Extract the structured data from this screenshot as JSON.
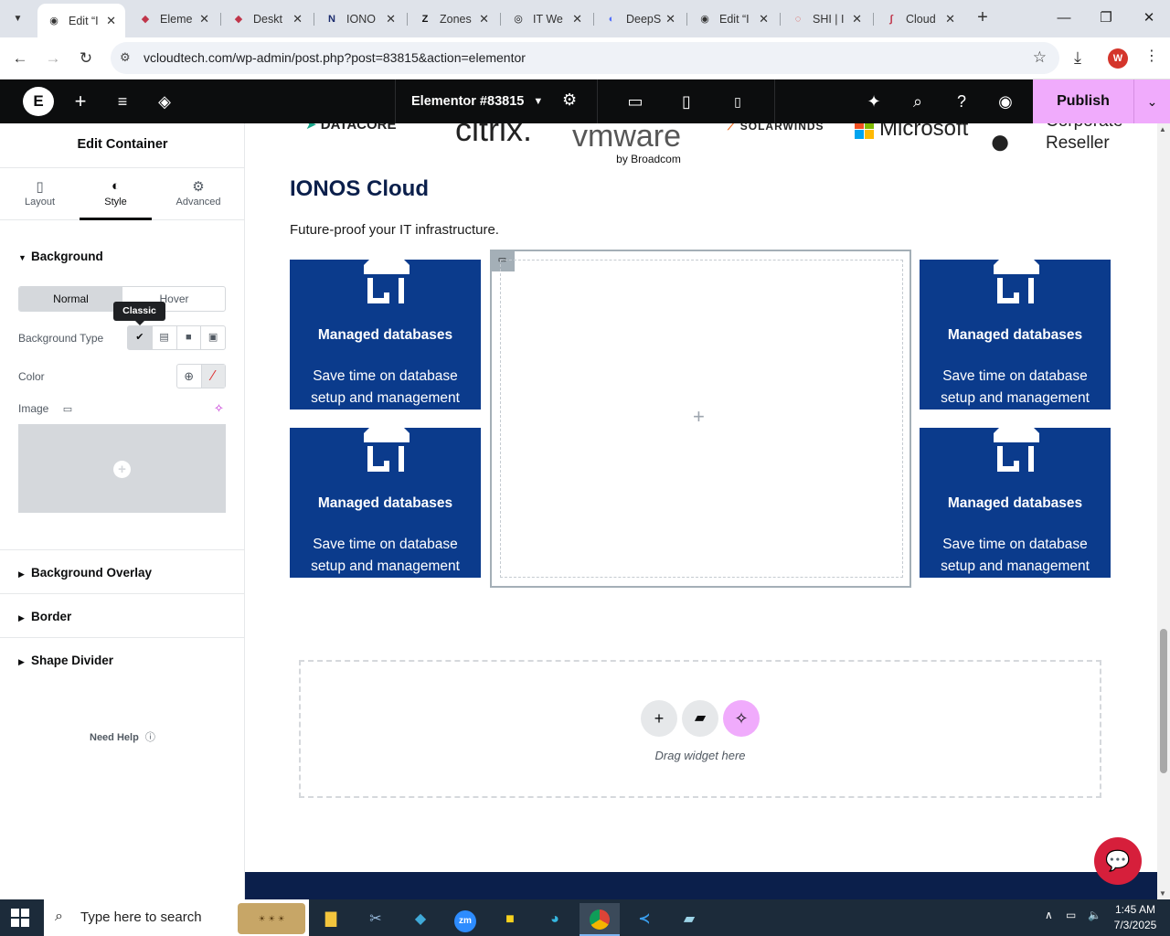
{
  "browser": {
    "tabs": [
      {
        "title": "Edit “I",
        "fav": "◉",
        "favcolor": "#333",
        "active": true
      },
      {
        "title": "Eleme",
        "fav": "◆",
        "favcolor": "#c0354a"
      },
      {
        "title": "Deskt",
        "fav": "◆",
        "favcolor": "#c0354a"
      },
      {
        "title": "IONO",
        "fav": "N",
        "favcolor": "#1a2b6d"
      },
      {
        "title": "Zones",
        "fav": "Z",
        "favcolor": "#111"
      },
      {
        "title": "IT We",
        "fav": "◎",
        "favcolor": "#111"
      },
      {
        "title": "DeepS",
        "fav": "◐",
        "favcolor": "#4d6bfe"
      },
      {
        "title": "Edit “I",
        "fav": "◉",
        "favcolor": "#333"
      },
      {
        "title": "SHI | I",
        "fav": "◌",
        "favcolor": "#d9342b"
      },
      {
        "title": "Cloud",
        "fav": "∫",
        "favcolor": "#c0354a"
      }
    ],
    "close_glyph": "✕",
    "new_tab": "+",
    "url": "vcloudtech.com/wp-admin/post.php?post=83815&action=elementor",
    "profile_initial": "W"
  },
  "elementor": {
    "doc_title": "Elementor #83815",
    "publish_label": "Publish"
  },
  "panel": {
    "title": "Edit Container",
    "tabs": [
      {
        "label": "Layout",
        "icon": "▯"
      },
      {
        "label": "Style",
        "icon": "◐"
      },
      {
        "label": "Advanced",
        "icon": "⚙"
      }
    ],
    "background": {
      "heading": "Background",
      "state_normal": "Normal",
      "state_hover": "Hover",
      "tooltip": "Classic",
      "type_label": "Background Type",
      "color_label": "Color",
      "image_label": "Image"
    },
    "sections": [
      "Background Overlay",
      "Border",
      "Shape Divider"
    ],
    "need_help": "Need Help"
  },
  "canvas": {
    "partner_logos": [
      {
        "text": "DATACORE",
        "color": "#1d6fb8"
      },
      {
        "text": "citrix.",
        "color": "#2b2b2b"
      },
      {
        "text": "vmware",
        "sub": "by Broadcom",
        "color": "#575757"
      },
      {
        "text": "SOLARWINDS",
        "color": "#f26b1d"
      },
      {
        "text": "Microsoft",
        "color": "#737373"
      },
      {
        "text": "Corporate Reseller",
        "color": "#111"
      }
    ],
    "heading": "IONOS Cloud",
    "subheading": "Future-proof your IT infrastructure.",
    "cards": [
      {
        "title": "Managed databases",
        "desc": "Save time on database setup and management"
      },
      {
        "title": "Managed databases",
        "desc": "Save time on database setup and management"
      },
      {
        "title": "Managed databases",
        "desc": "Save time on database setup and management"
      },
      {
        "title": "Managed databases",
        "desc": "Save time on database setup and management"
      }
    ],
    "drop_text": "Drag widget here"
  },
  "taskbar": {
    "search_placeholder": "Type here to search",
    "time": "1:45 AM",
    "date": "7/3/2025"
  },
  "colors": {
    "card_blue": "#0b3b8c",
    "publish_pink": "#f0abfc",
    "chat_red": "#d61f3b"
  }
}
